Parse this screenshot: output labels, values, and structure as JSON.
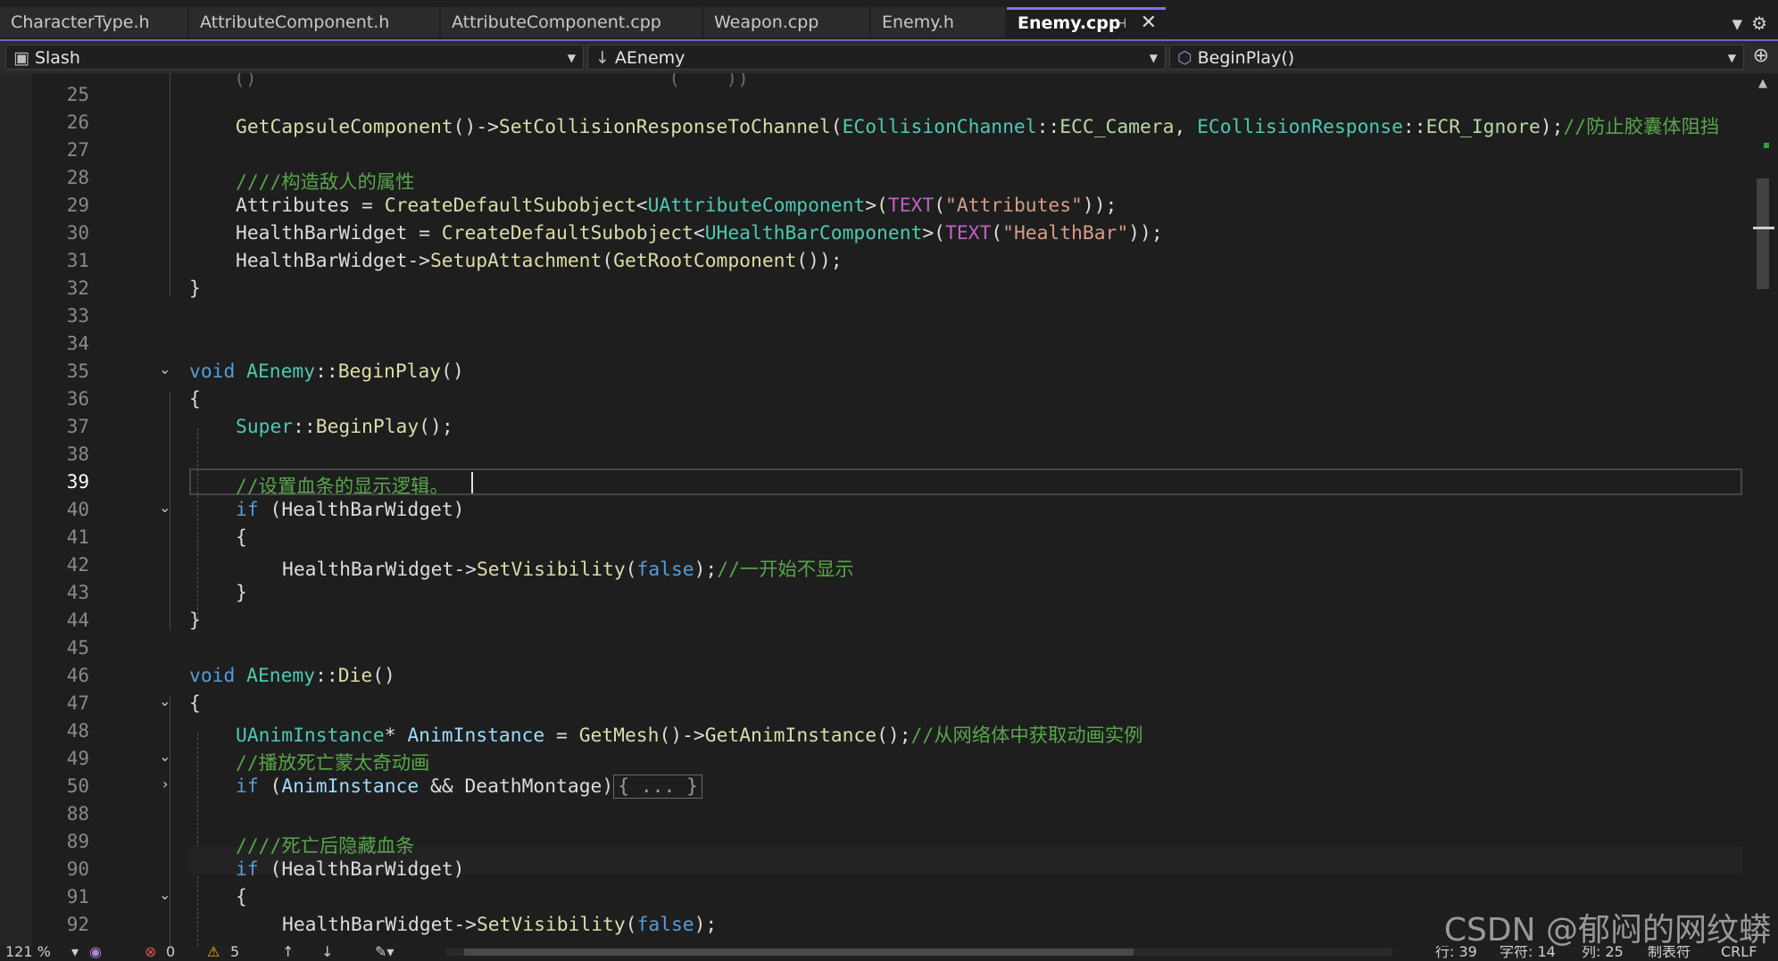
{
  "tabs": [
    {
      "label": "CharacterType.h"
    },
    {
      "label": "AttributeComponent.h"
    },
    {
      "label": "AttributeComponent.cpp"
    },
    {
      "label": "Weapon.cpp"
    },
    {
      "label": "Enemy.h"
    },
    {
      "label": "Enemy.cpp",
      "active": true
    }
  ],
  "nav": {
    "project": "Slash",
    "class_scope": "AEnemy",
    "member": "BeginPlay()"
  },
  "line_numbers": [
    "25",
    "26",
    "27",
    "28",
    "29",
    "30",
    "31",
    "32",
    "33",
    "34",
    "35",
    "36",
    "37",
    "38",
    "39",
    "40",
    "41",
    "42",
    "43",
    "44",
    "45",
    "46",
    "47",
    "48",
    "49",
    "50",
    "88",
    "89",
    "90",
    "91",
    "92"
  ],
  "current_line": "39",
  "code": {
    "l26_call": "GetCapsuleComponent",
    "l26_method": "SetCollisionResponseToChannel",
    "l26_enum1": "ECollisionChannel",
    "l26_val1": "ECC_Camera",
    "l26_enum2": "ECollisionResponse",
    "l26_val2": "ECR_Ignore",
    "l26_comment": "//防止胶囊体阻挡",
    "l28_comment": "////构造敌人的属性",
    "l29_var": "Attributes",
    "l29_fn": "CreateDefaultSubobject",
    "l29_type": "UAttributeComponent",
    "l29_macro": "TEXT",
    "l29_str": "\"Attributes\"",
    "l30_var": "HealthBarWidget",
    "l30_fn": "CreateDefaultSubobject",
    "l30_type": "UHealthBarComponent",
    "l30_macro": "TEXT",
    "l30_str": "\"HealthBar\"",
    "l31_var": "HealthBarWidget",
    "l31_fn": "SetupAttachment",
    "l31_arg": "GetRootComponent",
    "l35_void": "void",
    "l35_class": "AEnemy",
    "l35_fn": "BeginPlay",
    "l37_super": "Super",
    "l37_fn": "BeginPlay",
    "l39_comment": "//设置血条的显示逻辑。",
    "l40_if": "if",
    "l40_var": "HealthBarWidget",
    "l42_var": "HealthBarWidget",
    "l42_fn": "SetVisibility",
    "l42_false": "false",
    "l42_comment": "//一开始不显示",
    "l46_void": "void",
    "l46_class": "AEnemy",
    "l46_fn": "Die",
    "l48_type": "UAnimInstance",
    "l48_var": "AnimInstance",
    "l48_call": "GetMesh",
    "l48_fn": "GetAnimInstance",
    "l48_comment": "//从网络体中获取动画实例",
    "l49_comment": "//播放死亡蒙太奇动画",
    "l50_if": "if",
    "l50_var1": "AnimInstance",
    "l50_var2": "DeathMontage",
    "l50_collapsed": "{ ... }",
    "l89_comment": "////死亡后隐藏血条",
    "l90_if": "if",
    "l90_var": "HealthBarWidget",
    "l92_var": "HealthBarWidget",
    "l92_fn": "SetVisibility",
    "l92_false": "false"
  },
  "status": {
    "zoom": "121 %",
    "errors": "0",
    "warnings": "5",
    "line": "行: 39",
    "char": "字符: 14",
    "col": "列: 25",
    "tabs_mode": "制表符",
    "eol": "CRLF"
  },
  "watermark": "CSDN @郁闷的网纹蟒",
  "colors": {
    "accent": "#8b6ef0",
    "keyword": "#569cd6",
    "type": "#4ec9b0",
    "function": "#dcdcaa",
    "variable": "#9cdcfe",
    "string": "#d69d85",
    "comment": "#57a64a",
    "macro": "#bd63c5"
  },
  "icons": [
    "pin-icon",
    "close-icon",
    "dropdown-icon",
    "settings-icon",
    "project-icon",
    "scope-arrow-icon",
    "method-cube-icon",
    "split-icon",
    "fold-chevron-icon",
    "error-icon",
    "warning-icon",
    "up-arrow-icon",
    "down-arrow-icon",
    "brush-icon"
  ]
}
